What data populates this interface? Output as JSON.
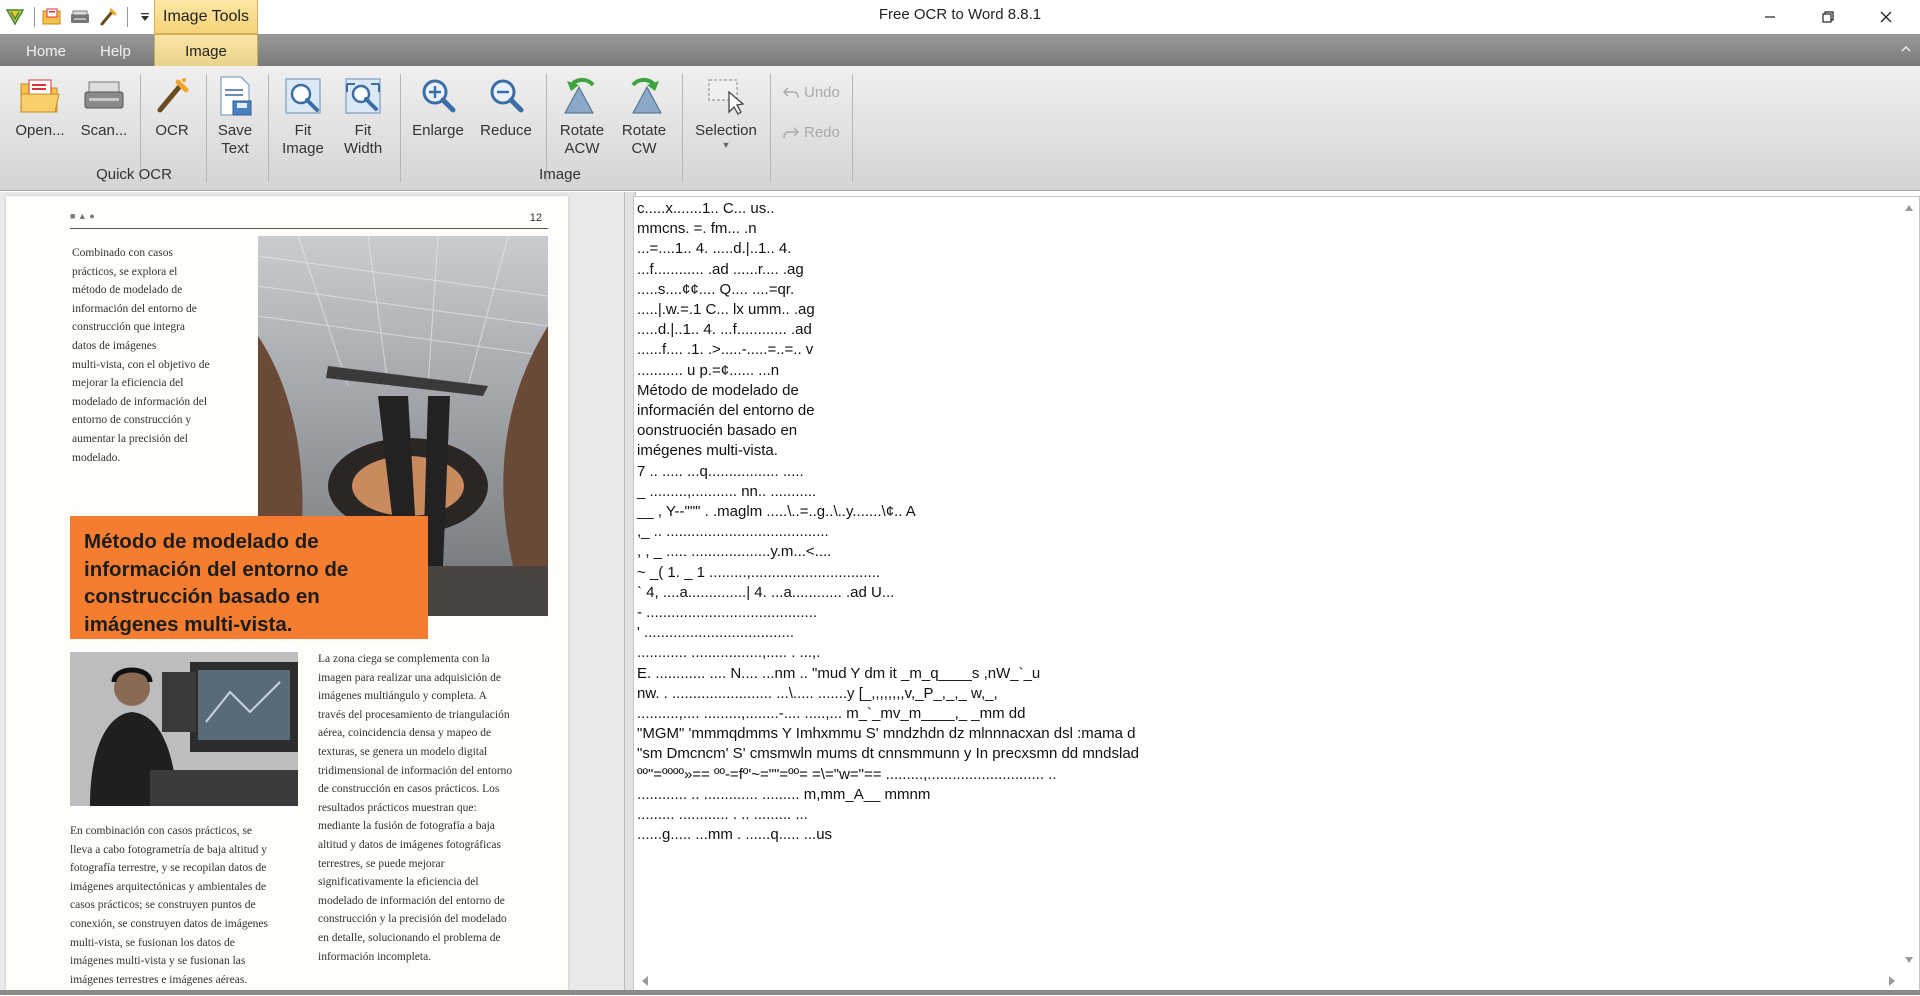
{
  "window": {
    "title": "Free OCR to Word 8.8.1",
    "context_tab": "Image Tools"
  },
  "tabs": [
    {
      "label": "Home"
    },
    {
      "label": "Help"
    },
    {
      "label": "Image"
    }
  ],
  "ribbon": {
    "open": "Open...",
    "scan": "Scan...",
    "ocr": "OCR",
    "save_text": [
      "Save",
      "Text"
    ],
    "fit_image": [
      "Fit",
      "Image"
    ],
    "fit_width": [
      "Fit",
      "Width"
    ],
    "enlarge": "Enlarge",
    "reduce": "Reduce",
    "rotate_acw": [
      "Rotate",
      "ACW"
    ],
    "rotate_cw": [
      "Rotate",
      "CW"
    ],
    "selection": "Selection",
    "undo": "Undo",
    "redo": "Redo",
    "group_quick_ocr": "Quick OCR",
    "group_image": "Image"
  },
  "document": {
    "page_number": "12",
    "col_a": [
      "Combinado con casos",
      "prácticos, se explora el",
      "método de modelado de",
      "información del entorno de",
      "construcción que integra",
      "datos de imágenes",
      "multi-vista, con el objetivo de",
      "mejorar la eficiencia del",
      "modelado de información del",
      "entorno de construcción y",
      "aumentar la precisión del",
      "modelado."
    ],
    "heading": [
      "Método de modelado de",
      "información del entorno de",
      "construcción basado en",
      "imágenes multi-vista."
    ],
    "col_b": [
      "La zona ciega se complementa con la",
      "imagen para realizar una adquisición de",
      "imágenes multiángulo y completa. A",
      "través del procesamiento de triangulación",
      "aérea, coincidencia densa y mapeo de",
      "texturas, se genera un modelo digital",
      "tridimensional de información del entorno",
      "de construcción en casos prácticos. Los",
      "resultados prácticos muestran que:",
      "mediante la fusión de fotografía a baja",
      "altitud y datos de imágenes fotográficas",
      "terrestres, se puede mejorar",
      "significativamente la eficiencia del",
      "modelado de información del entorno de",
      "construcción y la precisión del modelado",
      "en detalle, solucionando el problema de",
      "información incompleta."
    ],
    "col_c": [
      "En combinación con casos prácticos, se",
      "lleva a cabo fotogrametría de baja altitud y",
      "fotografía terrestre, y se recopilan datos de",
      "imágenes arquitectónicas y ambientales de",
      "casos prácticos; se construyen puntos de",
      "conexión, se construyen datos de imágenes",
      "multi-vista, se fusionan los datos de",
      "imágenes multi-vista y se fusionan las",
      "imágenes terrestres e imágenes aéreas."
    ]
  },
  "ocr_output": [
    "c.....x.......1.. C... us..",
    "mmcns. =. fm... .n",
    "...=....1.. 4. .....d.|..1.. 4.",
    "...f............ .ad ......r.... .ag",
    ".....s....¢¢.... Q.... ....=qr.",
    ".....|.w.=.1 C... lx umm.. .ag",
    ".....d.|..1.. 4. ...f............ .ad",
    "......f.... .1. .>.....-.....=..=.. v",
    "........... u p.=¢...... ...n",
    "Método de modelado de",
    "informacién del entorno de",
    "oonstruocién basado en",
    "imégenes multi-vista.",
    "7 .. ..... ...q................. .....",
    "_ .........,........... nn.. ...........",
    "__ , Y--\"\"\" . .maglm .....\\..=..g..\\..y.......\\¢.. A",
    ",_ .. .......................................",
    ", , _ ..... ...................y.m...<....",
    "~ _( 1. _ 1 .........,...............................",
    "` 4, ....a..............| 4. ...a............ .ad U...",
    "- .........................................",
    "' ....................................",
    "............ .................,..... . ...,.",
    "E. ............ .... N.... ...nm .. \"mud Y dm it _m_q____s ,nW_`_u",
    "nw. . ........................ ...\\..... .......y [_,,,,,,,,v,_P_,_,_ w,_,",
    "..........,.... .........,........-.... .....,... m_`_mv_m____,_ _mm dd",
    "\"MGM\" 'mmmqdmms Y Imhxmmu S' mndzhdn dz mlnnnacxan dsl :mama d",
    "\"sm Dmcncm' S' cmsmwln mums dt cnnsmmunn y In precxsmn dd mndslad",
    "ºº\"=ºººº»== ºº-=fº'~=\"\"=ºº= =\\=\"w=\"== .........,............................ ..",
    "............ .. ............. ......... m,mm_A__ mmnm",
    "......... ............ . .. ......... ...",
    "......g..... ...mm . ......q..... ...us"
  ],
  "colors": {
    "accent_orange": "#f47d30",
    "context_tab": "#f7d377",
    "tabbar": "#8a8a8a"
  }
}
